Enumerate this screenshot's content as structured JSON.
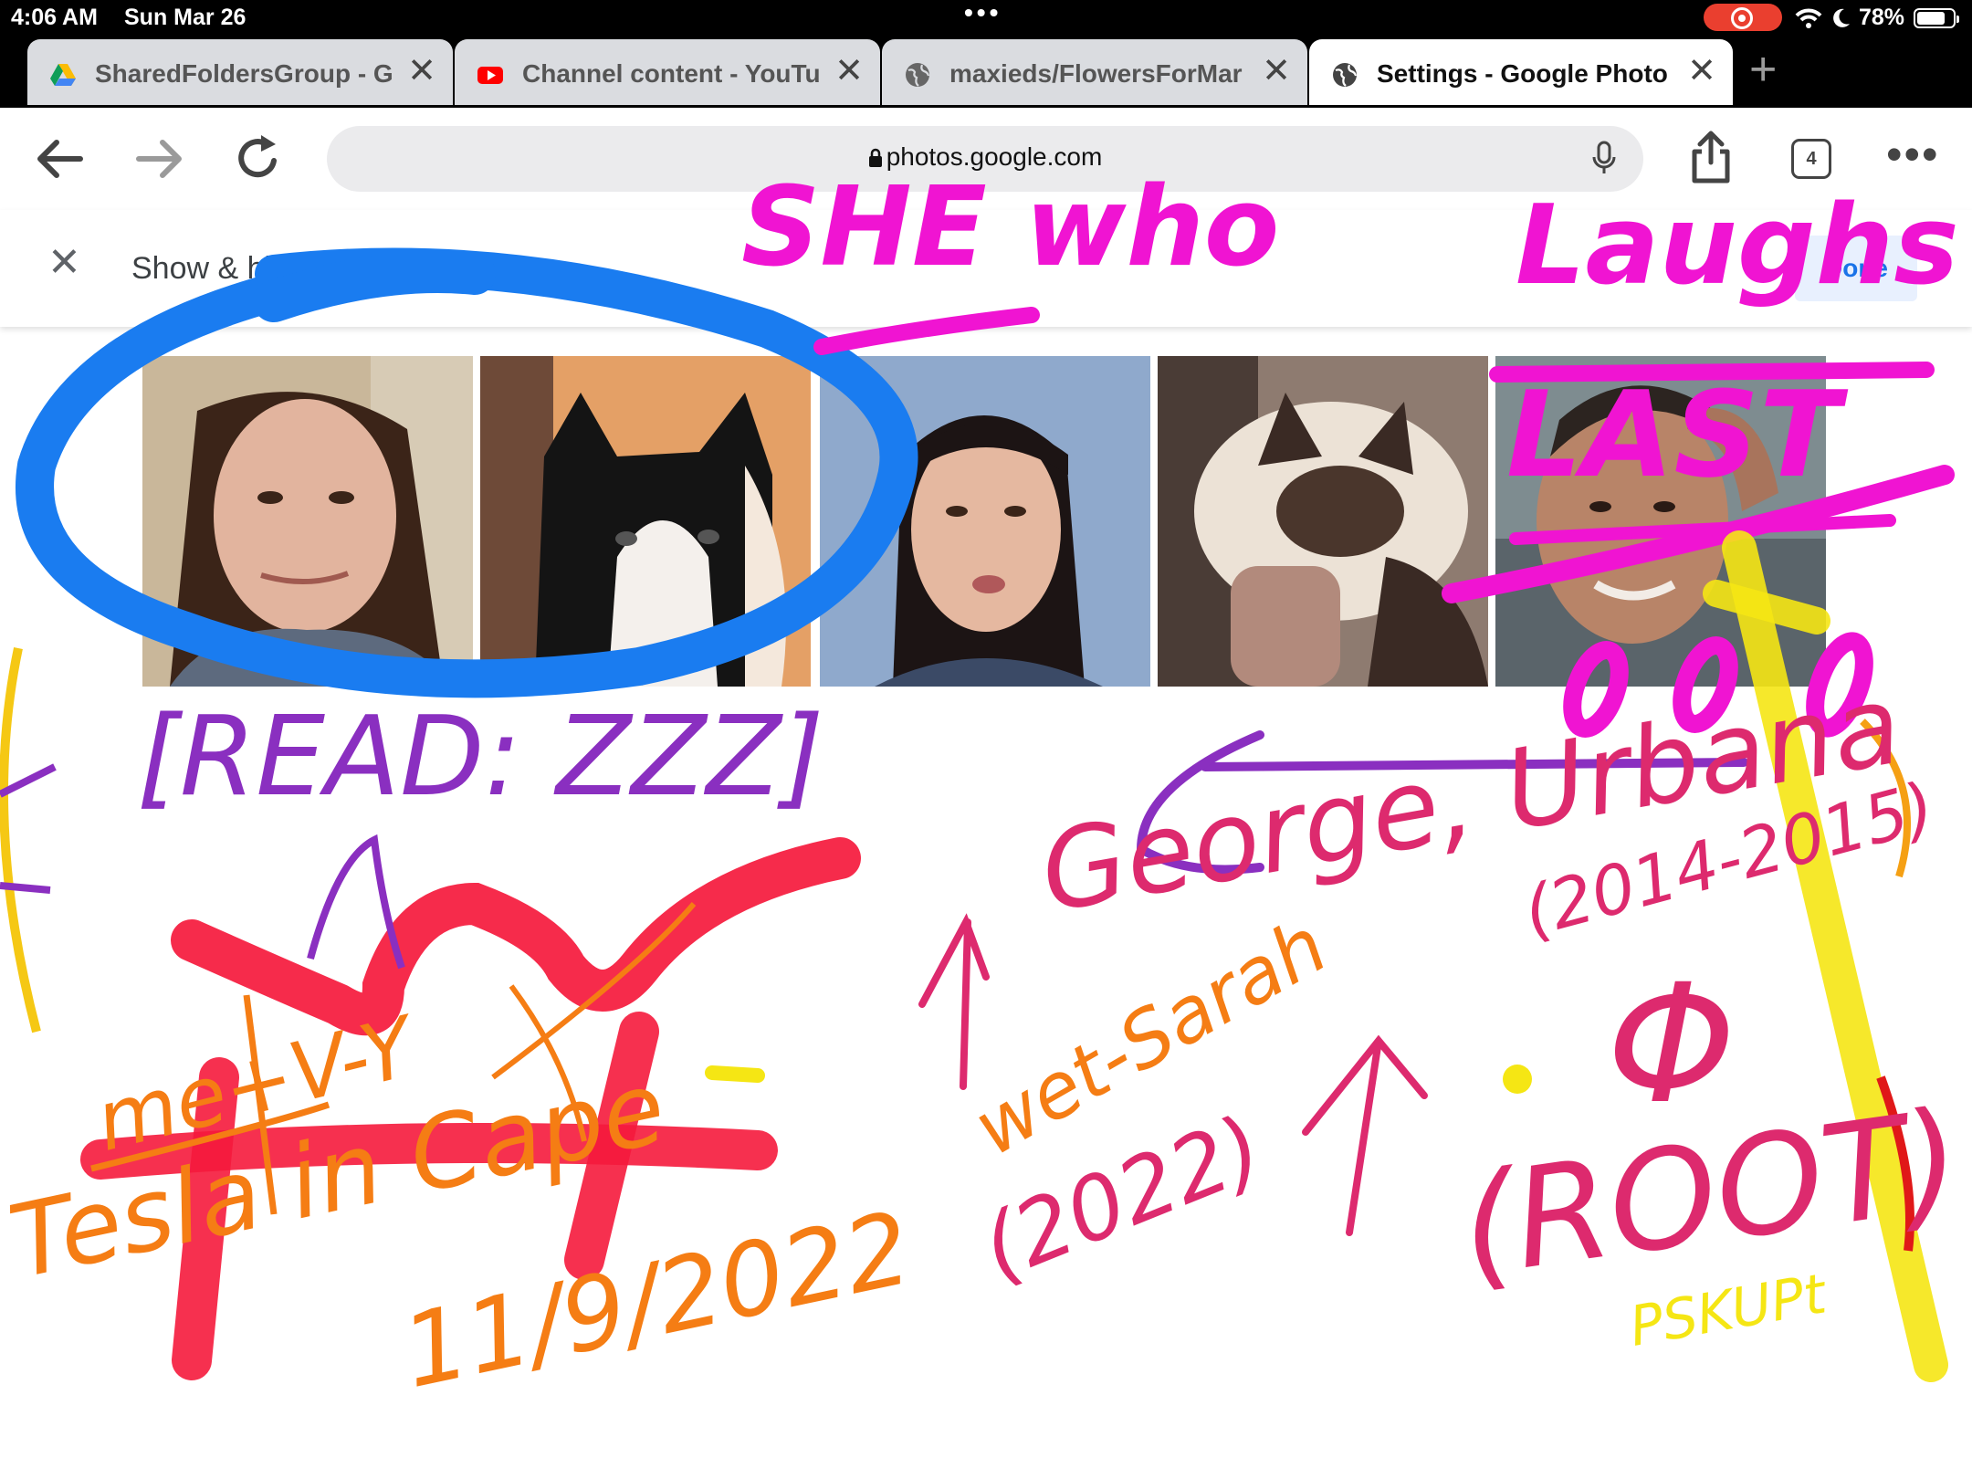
{
  "status_bar": {
    "time": "4:06 AM",
    "date": "Sun Mar 26",
    "battery": "78%",
    "battery_level": 0.78
  },
  "tabs": [
    {
      "title": "SharedFoldersGroup - G",
      "icon": "google-drive-icon",
      "active": false
    },
    {
      "title": "Channel content - YouTu",
      "icon": "youtube-icon",
      "active": false
    },
    {
      "title": "maxieds/FlowersForMar",
      "icon": "globe-icon",
      "active": false
    },
    {
      "title": "Settings - Google Photo",
      "icon": "globe-icon",
      "active": true
    }
  ],
  "toolbar": {
    "url": "photos.google.com",
    "tab_count": "4"
  },
  "page": {
    "title": "Show & hide faces",
    "done_label": "Done"
  },
  "faces": [
    {
      "subject": "woman-brown-hair"
    },
    {
      "subject": "black-white-cat"
    },
    {
      "subject": "woman-black-hair"
    },
    {
      "subject": "ragdoll-cat"
    },
    {
      "subject": "man"
    }
  ],
  "annotations": {
    "slogan_1": "SHE who",
    "slogan_2": "Laughs",
    "slogan_3": "LAST",
    "read_note": "[READ: ZZZ]",
    "george_note": "George, Urbana",
    "george_years": "(2014-2015)",
    "tesla_note": "Tesla in Cape",
    "tesla_date": "11/9/2022",
    "tesla_side": "me+V-Y",
    "wet_note": "wet-Sarah",
    "wet_year": "(2022)",
    "root_note": "(ROOT)",
    "phi": "Φ",
    "yellow_note": "PSKUPt"
  },
  "colors": {
    "magenta": "#f014d2",
    "blue": "#1a7cf0",
    "purple": "#8a2fc0",
    "red": "#f5193c",
    "crimson": "#dd2a6e",
    "orange": "#f57d14",
    "yellow": "#f5e614",
    "google_blue": "#1a73e8"
  }
}
